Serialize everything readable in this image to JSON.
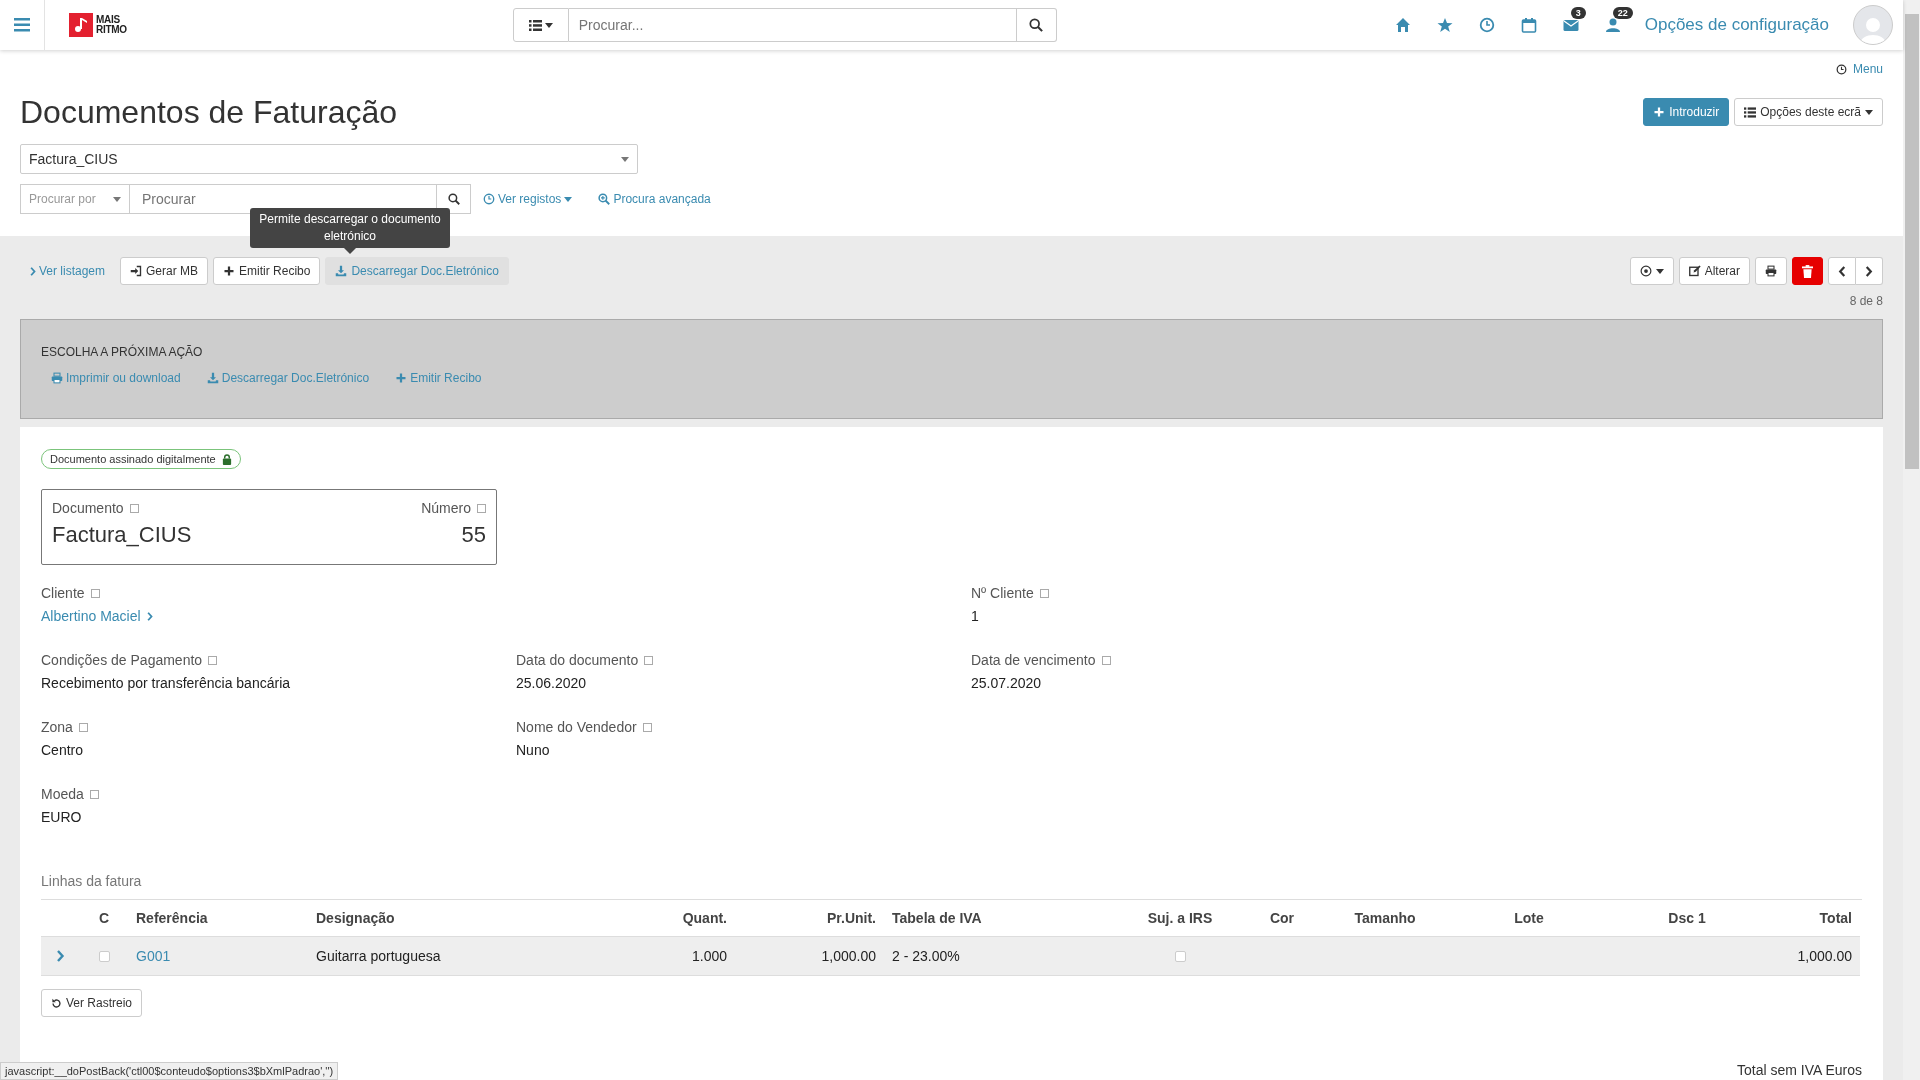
{
  "topbar": {
    "logo_text": [
      "MAIS",
      "RITMO"
    ],
    "search": {
      "placeholder": "Procurar..."
    },
    "icons": [
      {
        "kind": "home"
      },
      {
        "kind": "star"
      },
      {
        "kind": "clock"
      },
      {
        "kind": "calendar"
      },
      {
        "kind": "mail",
        "badge": "3"
      },
      {
        "kind": "user",
        "badge": "22"
      }
    ],
    "config_link": "Opções de configuração"
  },
  "menu_link": "Menu",
  "page_title": "Documentos de Faturação",
  "header_buttons": {
    "primary": "Introduzir",
    "options": "Opções deste ecrã"
  },
  "document_type_select": {
    "value": "Factura_CIUS"
  },
  "search_row": {
    "search_by": {
      "placeholder": "Procurar por"
    },
    "search": {
      "placeholder": "Procurar"
    },
    "view_records": "Ver registos",
    "advanced_search": "Procura avançada"
  },
  "tooltip": "Permite descarregar o documento eletrónico",
  "toolbar": {
    "list_link": "Ver listagem",
    "buttons": [
      {
        "kind": "login",
        "label": "Gerar MB",
        "hovered": false
      },
      {
        "kind": "plus",
        "label": "Emitir Recibo",
        "hovered": false
      },
      {
        "kind": "download",
        "label": "Descarregar Doc.Eletrónico",
        "hovered": true
      }
    ],
    "edit_button": "Alterar",
    "record_counter": "8 de 8"
  },
  "next_action": {
    "title": "ESCOLHA A PRÓXIMA AÇÃO",
    "links": [
      {
        "kind": "print",
        "label": "Imprimir ou download"
      },
      {
        "kind": "download",
        "label": "Descarregar Doc.Eletrónico"
      },
      {
        "kind": "plus",
        "label": "Emitir Recibo"
      }
    ]
  },
  "signed_badge": "Documento assinado digitalmente",
  "document_box": {
    "document_label": "Documento",
    "document_value": "Factura_CIUS",
    "number_label": "Número",
    "number_value": "55"
  },
  "field_rows": [
    {
      "left": {
        "label": "Cliente",
        "value": "Albertino Maciel",
        "kind": "link"
      },
      "right": {
        "label": "Nº Cliente",
        "value": "1",
        "kind": "text"
      }
    },
    {
      "left": {
        "label": "Condições de Pagamento",
        "value": "Recebimento por transferência bancária",
        "kind": "text"
      },
      "middle": {
        "label": "Data do documento",
        "value": "25.06.2020",
        "kind": "text"
      },
      "right": {
        "label": "Data de vencimento",
        "value": "25.07.2020",
        "kind": "text"
      }
    },
    {
      "left": {
        "label": "Zona",
        "value": "Centro",
        "kind": "text"
      },
      "middle": {
        "label": "Nome do Vendedor",
        "value": "Nuno",
        "kind": "text"
      }
    },
    {
      "left": {
        "label": "Moeda",
        "value": "EURO",
        "kind": "text"
      }
    }
  ],
  "lines": {
    "title": "Linhas da fatura",
    "columns": [
      "C",
      "Referência",
      "Designação",
      "Quant.",
      "Pr.Unit.",
      "Tabela de IVA",
      "Suj. a IRS",
      "Cor",
      "Tamanho",
      "Lote",
      "Dsc 1",
      "Total"
    ],
    "rows": [
      {
        "checked": false,
        "reference": "G001",
        "designation": "Guitarra portuguesa",
        "quantity": "1.000",
        "unit_price": "1,000.00",
        "vat_table": "2 - 23.00%",
        "irs": false,
        "total": "1,000.00"
      }
    ]
  },
  "trace_button": "Ver Rastreio",
  "total_label": "Total sem IVA Euros",
  "status_url": "javascript:__doPostBack('ctl00$conteudo$options3$bXmlPadrao','')"
}
